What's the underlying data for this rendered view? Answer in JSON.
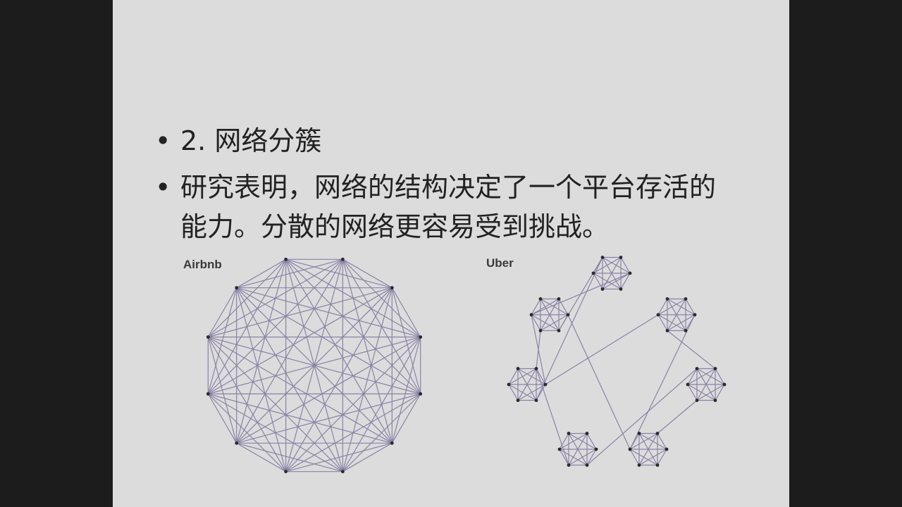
{
  "bullets": [
    {
      "text": "2. 网络分簇"
    },
    {
      "text": "研究表明，网络的结构决定了一个平台存活的能力。分散的网络更容易受到挑战。"
    }
  ],
  "diagrams": {
    "left_label": "Airbnb",
    "right_label": "Uber"
  },
  "colors": {
    "background": "#dcdcdc",
    "edge": "#8a82a6",
    "node": "#2a2a2a"
  }
}
